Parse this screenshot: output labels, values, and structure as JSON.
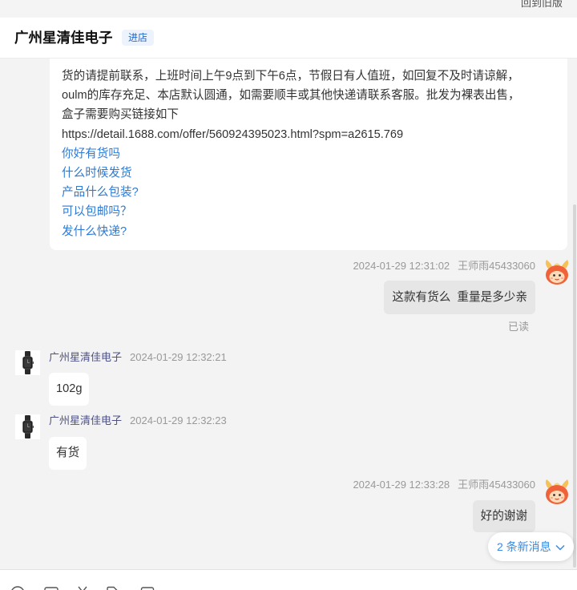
{
  "top_bar": {
    "back_to_old_label": "回到旧版"
  },
  "header": {
    "shop_name": "广州星清佳电子",
    "enter_shop_label": "进店"
  },
  "messages": {
    "intro": {
      "lines": [
        "货的请提前联系，上班时间上午9点到下午6点，节假日有人值班，如回复不及时请谅解，",
        "oulm的库存充足、本店默认圆通，如需要顺丰或其他快递请联系客服。批发为裸表出售，",
        "盒子需要购买链接如下",
        "https://detail.1688.com/offer/560924395023.html?spm=a2615.769"
      ],
      "quick_questions": [
        "你好有货吗",
        "什么时候发货",
        "产品什么包装?",
        "可以包邮吗？",
        "发什么快递?"
      ]
    },
    "m1": {
      "time": "2024-01-29 12:31:02",
      "sender": "王师雨45433060",
      "text": "这款有货么  重量是多少亲",
      "status": "已读"
    },
    "m2": {
      "sender": "广州星清佳电子",
      "time": "2024-01-29 12:32:21",
      "text": "102g"
    },
    "m3": {
      "sender": "广州星清佳电子",
      "time": "2024-01-29 12:32:23",
      "text": "有货"
    },
    "m4": {
      "time": "2024-01-29 12:33:28",
      "sender": "王师雨45433060",
      "text": "好的谢谢"
    }
  },
  "new_messages": {
    "label": "2 条新消息",
    "icon": "chevron-down-icon"
  },
  "avatars": {
    "buyer": "cartoon-avatar-icon",
    "shop": "watch-avatar-icon"
  },
  "toolbar": {
    "icons": [
      "emoji-icon",
      "image-icon",
      "scissors-icon",
      "file-icon",
      "window-icon"
    ]
  },
  "colors": {
    "link": "#2e7ad4",
    "accent": "#3b8ae4",
    "shop_name": "#4d5189",
    "badge": "#1f66cc"
  }
}
